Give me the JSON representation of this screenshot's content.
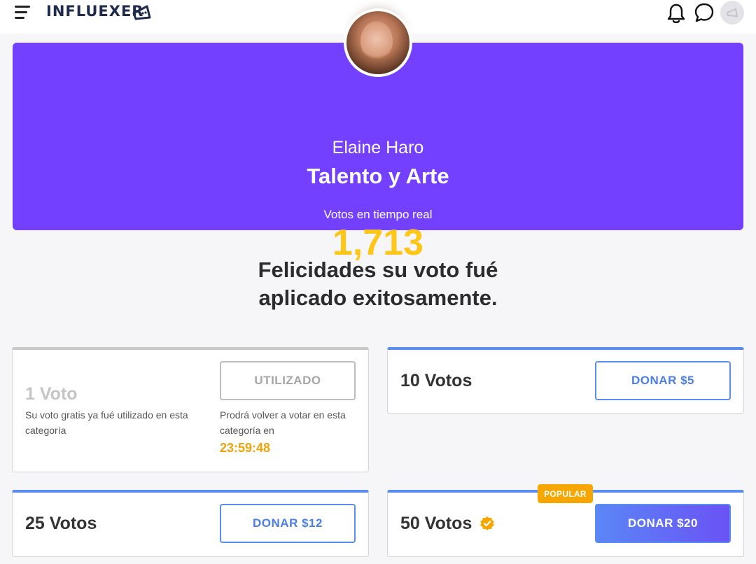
{
  "header": {
    "logo_text": "INFLUEXER"
  },
  "hero": {
    "name": "Elaine Haro",
    "category": "Talento y Arte",
    "votes_label": "Votos en tiempo real",
    "votes": "1,713"
  },
  "message": {
    "line1": "Felicidades su voto fué",
    "line2": "aplicado exitosamente."
  },
  "cards": {
    "free": {
      "title": "1 Voto",
      "desc": "Su voto gratis ya fué utilizado en esta categoría",
      "button": "UTILIZADO",
      "next_text": "Prodrá volver a votar en esta categoría en",
      "timer": "23:59:48"
    },
    "ten": {
      "title": "10 Votos",
      "button": "DONAR $5"
    },
    "twentyfive": {
      "title": "25 Votos",
      "button": "DONAR $12"
    },
    "fifty": {
      "title": "50 Votos",
      "button": "DONAR $20",
      "badge": "POPULAR"
    }
  },
  "colors": {
    "hero": "#7340ff",
    "accent": "#5b8def",
    "votes": "#ffc61a",
    "timer": "#f2a20a",
    "popular": "#f7a600"
  }
}
